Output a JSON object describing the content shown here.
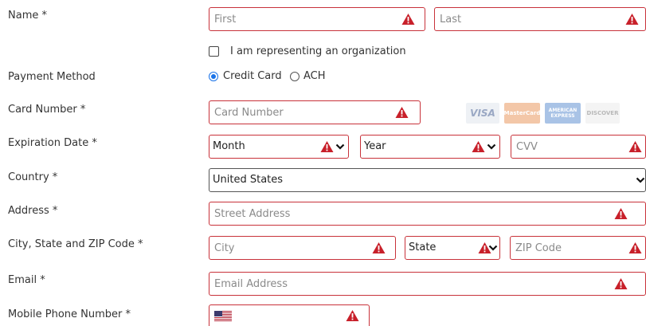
{
  "labels": {
    "name": "Name *",
    "payment_method": "Payment Method",
    "card_number": "Card Number *",
    "expiration_date": "Expiration Date *",
    "country": "Country *",
    "address": "Address *",
    "city_state_zip": "City, State and ZIP Code *",
    "email": "Email *",
    "mobile_phone": "Mobile Phone Number *"
  },
  "name": {
    "first_placeholder": "First",
    "last_placeholder": "Last"
  },
  "organization_checkbox_label": "I am representing an organization",
  "payment": {
    "credit_card_label": "Credit Card",
    "ach_label": "ACH",
    "selected": "Credit Card"
  },
  "card": {
    "number_placeholder": "Card Number",
    "logos": [
      "VISA",
      "MasterCard",
      "AMERICAN EXPRESS",
      "DISCOVER"
    ]
  },
  "expiration": {
    "month_value": "Month",
    "year_value": "Year",
    "cvv_placeholder": "CVV"
  },
  "country": {
    "value": "United States"
  },
  "address": {
    "street_placeholder": "Street Address"
  },
  "location": {
    "city_placeholder": "City",
    "state_value": "State",
    "zip_placeholder": "ZIP Code"
  },
  "email": {
    "placeholder": "Email Address"
  },
  "colors": {
    "error_red": "#c8323a",
    "warning_icon": "#c8202a",
    "radio_blue": "#1a73e8"
  },
  "icons": {
    "warning": "warning-triangle-icon",
    "dropdown": "chevron-down-icon",
    "flag": "us-flag-icon"
  }
}
